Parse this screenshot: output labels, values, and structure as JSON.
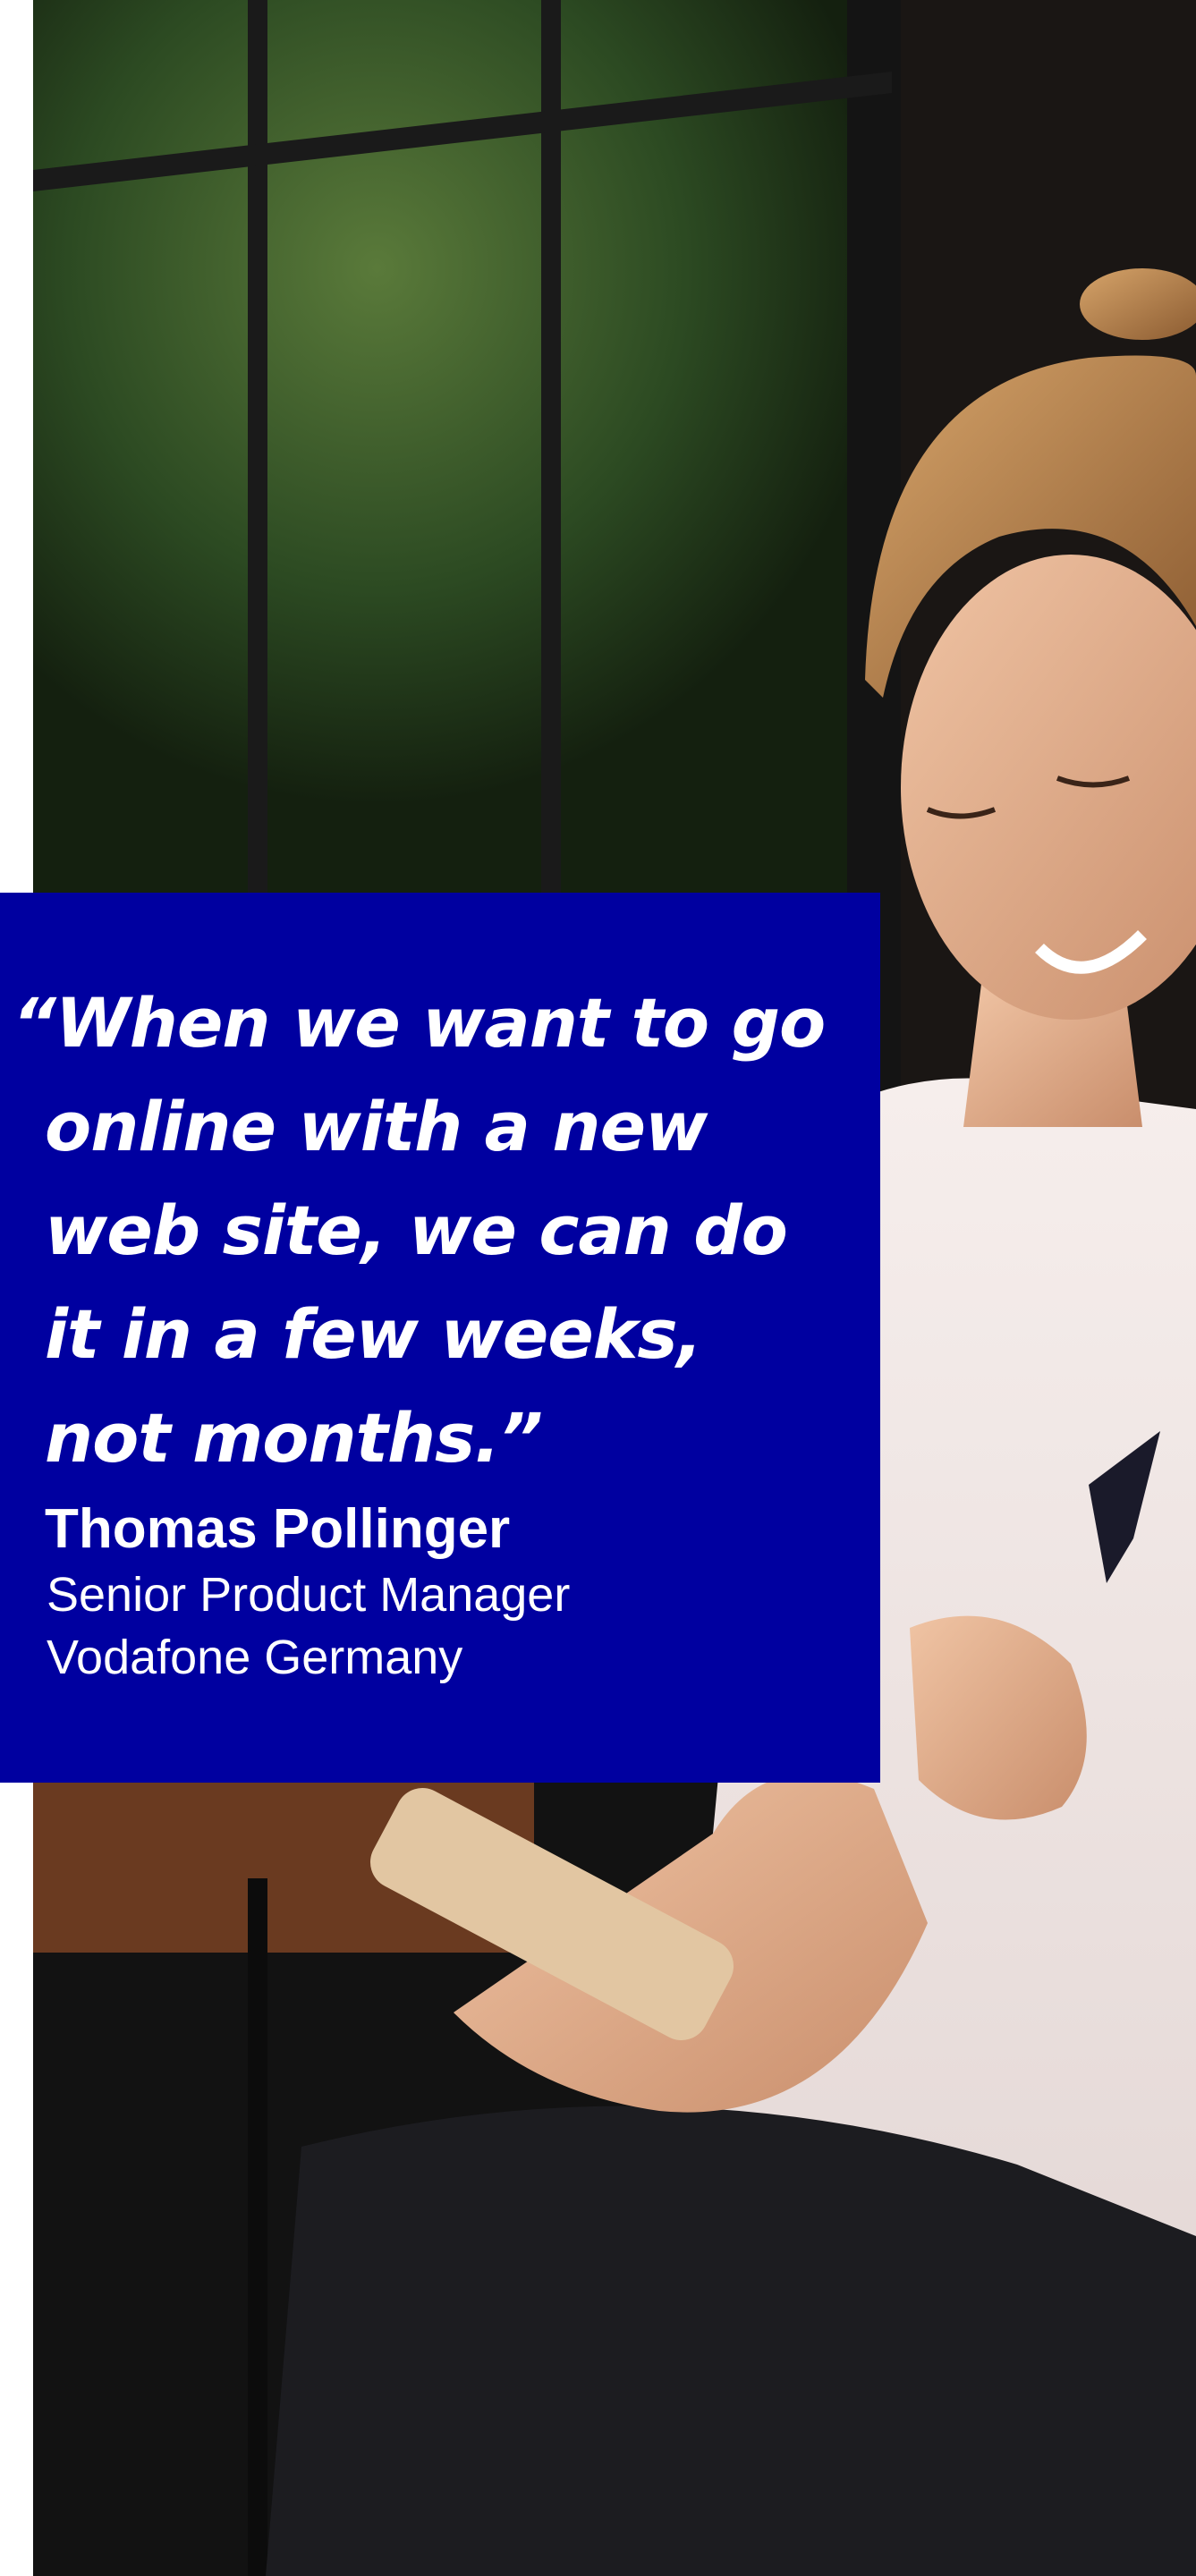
{
  "quote": {
    "lines": [
      "“When we want to go",
      "online with a new",
      "web site, we can do",
      "it in a few weeks,",
      "not months.”"
    ]
  },
  "author": {
    "name": "Thomas Pollinger",
    "title": "Senior Product Manager",
    "company": "Vodafone Germany"
  },
  "colors": {
    "card_background": "#0000a0",
    "text": "#ffffff"
  }
}
